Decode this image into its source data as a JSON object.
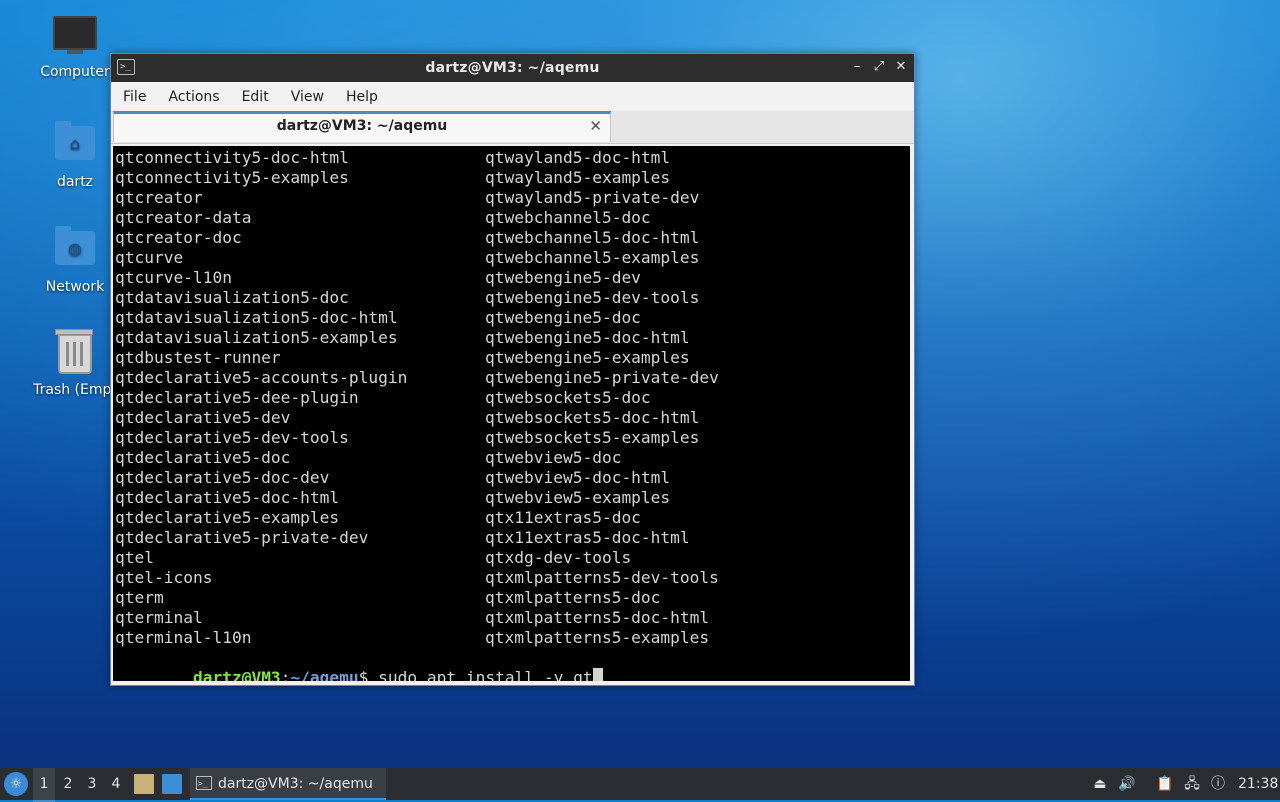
{
  "desktop": {
    "icons": [
      {
        "label": "Computer"
      },
      {
        "label": "dartz"
      },
      {
        "label": "Network"
      },
      {
        "label": "Trash (Empt"
      }
    ]
  },
  "window": {
    "title": "dartz@VM3: ~/aqemu",
    "app_icon": ">_",
    "controls": {
      "minimize": "–",
      "maximize": "⤢",
      "close": "✕"
    },
    "menu": [
      "File",
      "Actions",
      "Edit",
      "View",
      "Help"
    ],
    "tab": {
      "label": "dartz@VM3: ~/aqemu",
      "close": "✕"
    }
  },
  "terminal": {
    "rows": [
      [
        "qtconnectivity5-doc-html",
        "qtwayland5-doc-html"
      ],
      [
        "qtconnectivity5-examples",
        "qtwayland5-examples"
      ],
      [
        "qtcreator",
        "qtwayland5-private-dev"
      ],
      [
        "qtcreator-data",
        "qtwebchannel5-doc"
      ],
      [
        "qtcreator-doc",
        "qtwebchannel5-doc-html"
      ],
      [
        "qtcurve",
        "qtwebchannel5-examples"
      ],
      [
        "qtcurve-l10n",
        "qtwebengine5-dev"
      ],
      [
        "qtdatavisualization5-doc",
        "qtwebengine5-dev-tools"
      ],
      [
        "qtdatavisualization5-doc-html",
        "qtwebengine5-doc"
      ],
      [
        "qtdatavisualization5-examples",
        "qtwebengine5-doc-html"
      ],
      [
        "qtdbustest-runner",
        "qtwebengine5-examples"
      ],
      [
        "qtdeclarative5-accounts-plugin",
        "qtwebengine5-private-dev"
      ],
      [
        "qtdeclarative5-dee-plugin",
        "qtwebsockets5-doc"
      ],
      [
        "qtdeclarative5-dev",
        "qtwebsockets5-doc-html"
      ],
      [
        "qtdeclarative5-dev-tools",
        "qtwebsockets5-examples"
      ],
      [
        "qtdeclarative5-doc",
        "qtwebview5-doc"
      ],
      [
        "qtdeclarative5-doc-dev",
        "qtwebview5-doc-html"
      ],
      [
        "qtdeclarative5-doc-html",
        "qtwebview5-examples"
      ],
      [
        "qtdeclarative5-examples",
        "qtx11extras5-doc"
      ],
      [
        "qtdeclarative5-private-dev",
        "qtx11extras5-doc-html"
      ],
      [
        "qtel",
        "qtxdg-dev-tools"
      ],
      [
        "qtel-icons",
        "qtxmlpatterns5-dev-tools"
      ],
      [
        "qterm",
        "qtxmlpatterns5-doc"
      ],
      [
        "qterminal",
        "qtxmlpatterns5-doc-html"
      ],
      [
        "qterminal-l10n",
        "qtxmlpatterns5-examples"
      ]
    ],
    "prompt": {
      "user": "dartz@VM3",
      "sep": ":",
      "path": "~/aqemu",
      "symbol": "$ ",
      "command": "sudo apt install -y qt"
    }
  },
  "taskbar": {
    "start_icon": "start-menu-icon",
    "workspaces": [
      "1",
      "2",
      "3",
      "4"
    ],
    "active_workspace": "1",
    "task": {
      "label": "dartz@VM3: ~/aqemu"
    },
    "clock": "21:38"
  }
}
